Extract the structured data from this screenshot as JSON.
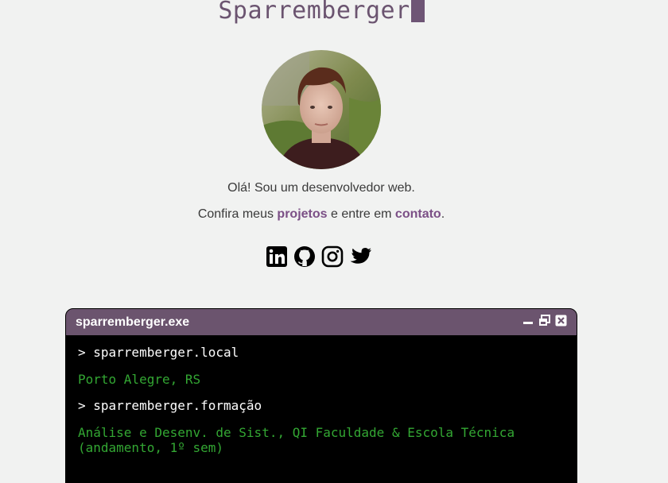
{
  "header": {
    "title": "Sparremberger"
  },
  "profile": {
    "greeting": "Olá! Sou um desenvolvedor web.",
    "cta_prefix": "Confira meus ",
    "projects_link": "projetos",
    "cta_middle": " e entre em ",
    "contact_link": "contato",
    "cta_suffix": "."
  },
  "socials": [
    {
      "icon": "linkedin-icon"
    },
    {
      "icon": "github-icon"
    },
    {
      "icon": "instagram-icon"
    },
    {
      "icon": "twitter-icon"
    }
  ],
  "terminal": {
    "title": "sparremberger.exe",
    "lines": [
      {
        "type": "command",
        "text": "> sparremberger.local"
      },
      {
        "type": "output",
        "text": "Porto Alegre, RS"
      },
      {
        "type": "command",
        "text": "> sparremberger.formação"
      },
      {
        "type": "output",
        "text": "Análise e Desenv. de Sist., QI Faculdade & Escola Técnica (andamento, 1º sem)"
      }
    ]
  },
  "colors": {
    "background": "#f1f2f1",
    "accent": "#6b546e",
    "link": "#7b4f86",
    "terminal_bg": "#000000",
    "terminal_output": "#33a733"
  }
}
